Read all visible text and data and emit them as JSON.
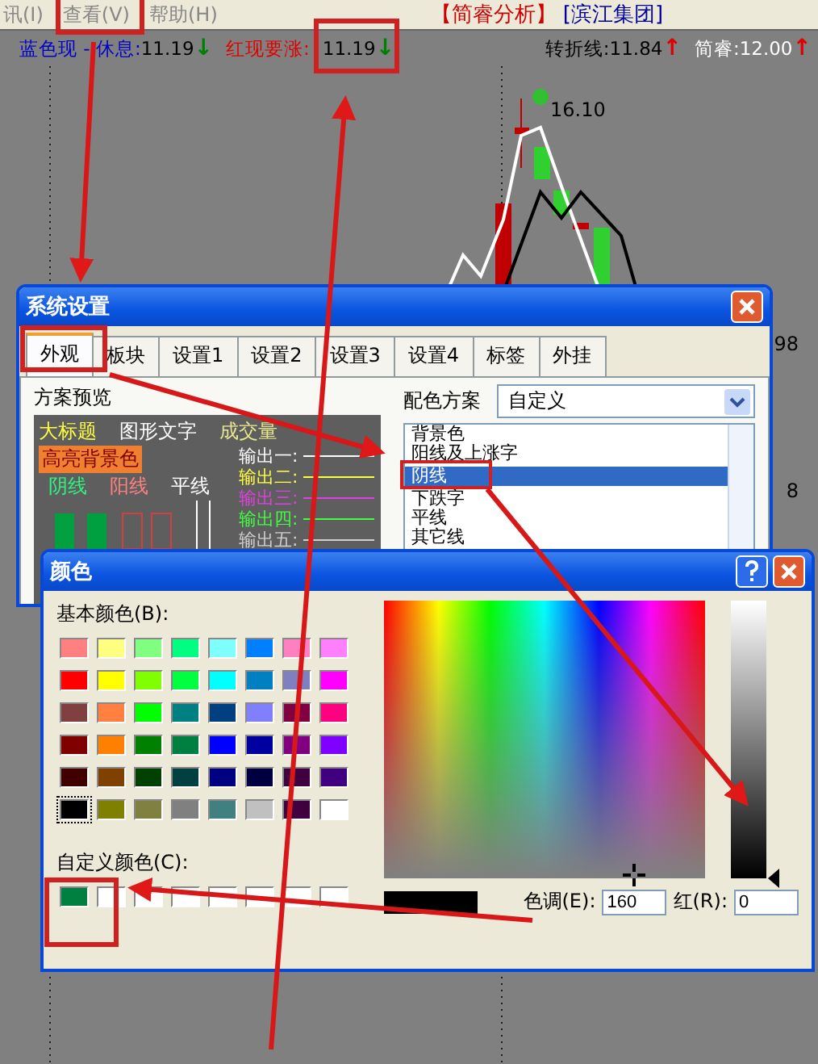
{
  "menu": {
    "items": [
      "讯(I)",
      "查看(V)",
      "帮助(H)"
    ],
    "app_title": "【简睿分析】",
    "stock": "[滨江集团]"
  },
  "indicators": [
    {
      "label": "蓝色现 - 休息:",
      "value": "11.19",
      "color": "#0000c8",
      "arrow": {
        "text": "↓",
        "color": "#008000"
      }
    },
    {
      "label": "红现要涨:",
      "value": "11.19",
      "color": "#e00000",
      "arrow": {
        "text": "↓",
        "color": "#008000"
      }
    },
    {
      "label": "转折线:",
      "value": "11.84",
      "color": "#000000",
      "arrow": {
        "text": "↑",
        "color": "#e00000"
      }
    },
    {
      "label": "简睿:",
      "value": "12.00",
      "color": "#ffffff",
      "arrow": {
        "text": "↑",
        "color": "#e00000"
      }
    }
  ],
  "chart": {
    "price_label": "16.10",
    "axis_labels": [
      "98",
      "8"
    ]
  },
  "settings_dialog": {
    "title": "系统设置",
    "tabs": [
      {
        "label": "外观",
        "selected": true
      },
      {
        "label": "板块",
        "selected": false
      },
      {
        "label": "设置1",
        "selected": false
      },
      {
        "label": "设置2",
        "selected": false
      },
      {
        "label": "设置3",
        "selected": false
      },
      {
        "label": "设置4",
        "selected": false
      },
      {
        "label": "标签",
        "selected": false
      },
      {
        "label": "外挂",
        "selected": false
      }
    ],
    "preview_label": "方案预览",
    "preview": {
      "big_title": "大标题",
      "graph_text": "图形文字",
      "volume": "成交量",
      "highlight": "高亮背景色",
      "down_candle": "阴线",
      "up_candle": "阳线",
      "flat_line": "平线",
      "outputs": [
        {
          "label": "输出一:",
          "color": "#ffffff"
        },
        {
          "label": "输出二:",
          "color": "#ffff40"
        },
        {
          "label": "输出三:",
          "color": "#e040e0"
        },
        {
          "label": "输出四:",
          "color": "#40ff40"
        },
        {
          "label": "输出五:",
          "color": "#d0d0d0"
        }
      ]
    },
    "scheme_label": "配色方案",
    "scheme_value": "自定义",
    "items": [
      {
        "label": "背景色",
        "selected": false
      },
      {
        "label": "阳线及上涨字",
        "selected": false
      },
      {
        "label": "阴线",
        "selected": true
      },
      {
        "label": "下跌字",
        "selected": false
      },
      {
        "label": "平线",
        "selected": false
      },
      {
        "label": "其它线",
        "selected": false
      }
    ]
  },
  "color_dialog": {
    "title": "颜色",
    "basic_label": "基本颜色(B):",
    "basic_colors": [
      {
        "color": "#ff8080",
        "selected": false
      },
      {
        "color": "#ffff80",
        "selected": false
      },
      {
        "color": "#80ff80",
        "selected": false
      },
      {
        "color": "#00ff80",
        "selected": false
      },
      {
        "color": "#80ffff",
        "selected": false
      },
      {
        "color": "#0080ff",
        "selected": false
      },
      {
        "color": "#ff80c0",
        "selected": false
      },
      {
        "color": "#ff80ff",
        "selected": false
      },
      {
        "color": "#ff0000",
        "selected": false
      },
      {
        "color": "#ffff00",
        "selected": false
      },
      {
        "color": "#80ff00",
        "selected": false
      },
      {
        "color": "#00ff40",
        "selected": false
      },
      {
        "color": "#00ffff",
        "selected": false
      },
      {
        "color": "#0080c0",
        "selected": false
      },
      {
        "color": "#8080c0",
        "selected": false
      },
      {
        "color": "#ff00ff",
        "selected": false
      },
      {
        "color": "#804040",
        "selected": false
      },
      {
        "color": "#ff8040",
        "selected": false
      },
      {
        "color": "#00ff00",
        "selected": false
      },
      {
        "color": "#008080",
        "selected": false
      },
      {
        "color": "#004080",
        "selected": false
      },
      {
        "color": "#8080ff",
        "selected": false
      },
      {
        "color": "#800040",
        "selected": false
      },
      {
        "color": "#ff0080",
        "selected": false
      },
      {
        "color": "#800000",
        "selected": false
      },
      {
        "color": "#ff8000",
        "selected": false
      },
      {
        "color": "#008000",
        "selected": false
      },
      {
        "color": "#008040",
        "selected": false
      },
      {
        "color": "#0000ff",
        "selected": false
      },
      {
        "color": "#0000a0",
        "selected": false
      },
      {
        "color": "#800080",
        "selected": false
      },
      {
        "color": "#8000ff",
        "selected": false
      },
      {
        "color": "#400000",
        "selected": false
      },
      {
        "color": "#804000",
        "selected": false
      },
      {
        "color": "#004000",
        "selected": false
      },
      {
        "color": "#004040",
        "selected": false
      },
      {
        "color": "#000080",
        "selected": false
      },
      {
        "color": "#000040",
        "selected": false
      },
      {
        "color": "#400040",
        "selected": false
      },
      {
        "color": "#400080",
        "selected": false
      },
      {
        "color": "#000000",
        "selected": true
      },
      {
        "color": "#808000",
        "selected": false
      },
      {
        "color": "#808040",
        "selected": false
      },
      {
        "color": "#808080",
        "selected": false
      },
      {
        "color": "#408080",
        "selected": false
      },
      {
        "color": "#c0c0c0",
        "selected": false
      },
      {
        "color": "#400040",
        "selected": false
      },
      {
        "color": "#ffffff",
        "selected": false
      }
    ],
    "custom_label": "自定义颜色(C):",
    "custom_colors": [
      {
        "color": "#008040"
      },
      {
        "color": "#ffffff"
      },
      {
        "color": "#ffffff"
      },
      {
        "color": "#ffffff"
      },
      {
        "color": "#ffffff"
      },
      {
        "color": "#ffffff"
      },
      {
        "color": "#ffffff"
      },
      {
        "color": "#ffffff"
      }
    ],
    "hue_label": "色调(E):",
    "hue": "160",
    "red_label": "红(R):",
    "red": "0"
  }
}
